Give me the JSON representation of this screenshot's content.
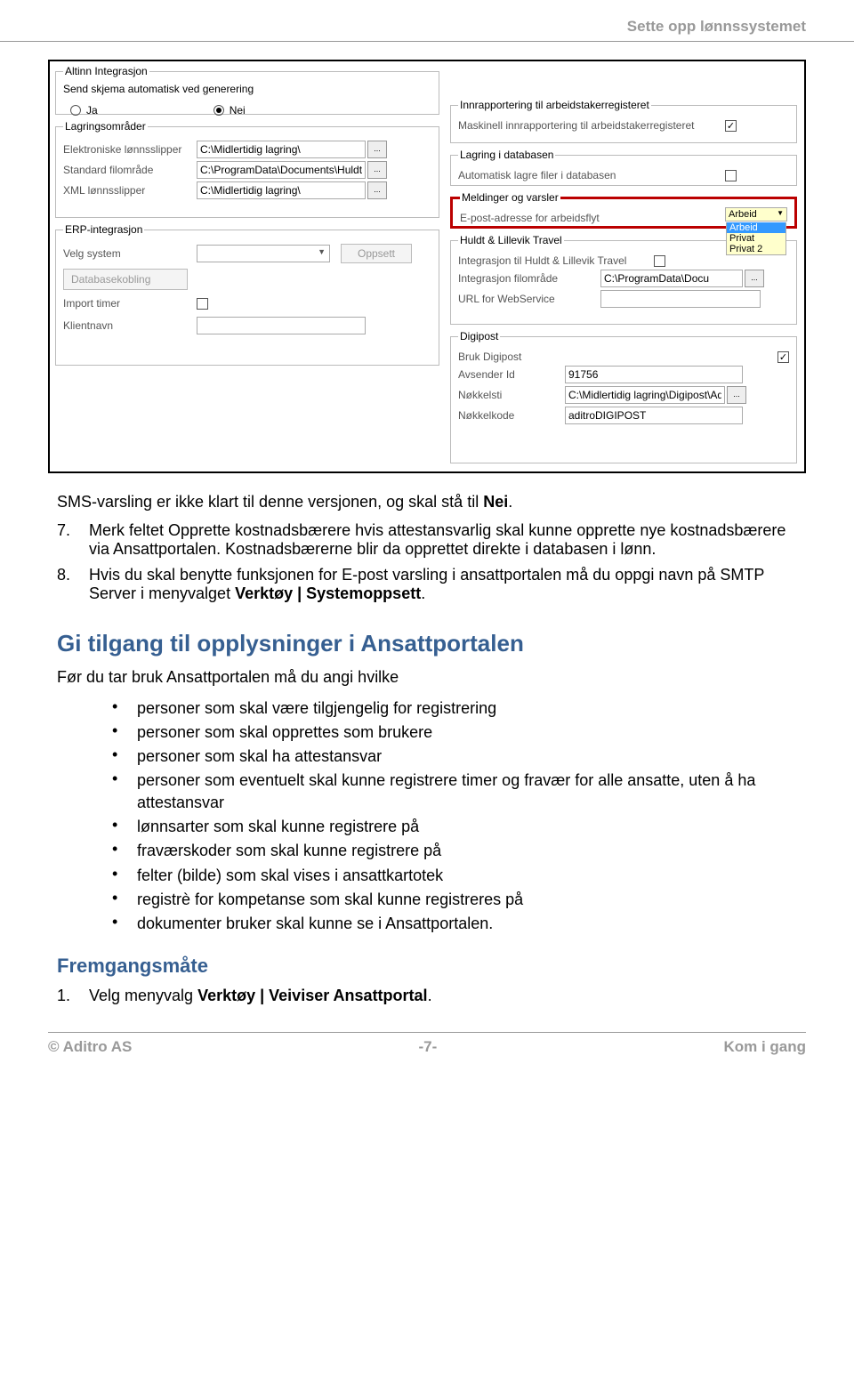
{
  "header": {
    "title": "Sette opp lønnssystemet"
  },
  "screenshot": {
    "altinn": {
      "legend": "Altinn Integrasjon",
      "sublabel": "Send skjema automatisk ved generering",
      "opt_yes": "Ja",
      "opt_no": "Nei"
    },
    "lagring": {
      "legend": "Lagringsområder",
      "r1_label": "Elektroniske lønnsslipper",
      "r1_value": "C:\\Midlertidig lagring\\",
      "r2_label": "Standard filområde",
      "r2_value": "C:\\ProgramData\\Documents\\HuldtLille\\",
      "r3_label": "XML lønnsslipper",
      "r3_value": "C:\\Midlertidig lagring\\"
    },
    "erp": {
      "legend": "ERP-integrasjon",
      "r1_label": "Velg system",
      "btn_oppsett": "Oppsett",
      "btn_db": "Databasekobling",
      "r2_label": "Import timer",
      "r3_label": "Klientnavn"
    },
    "innrap": {
      "legend": "Innrapportering til arbeidstakerregisteret",
      "label": "Maskinell innrapportering til arbeidstakerregisteret"
    },
    "lagdb": {
      "legend": "Lagring i databasen",
      "label": "Automatisk lagre filer i databasen"
    },
    "meld": {
      "legend": "Meldinger og varsler",
      "label": "E-post-adresse for arbeidsflyt",
      "selected": "Arbeid",
      "opts": [
        "Arbeid",
        "Privat",
        "Privat 2"
      ]
    },
    "travel": {
      "legend": "Huldt & Lillevik Travel",
      "r1_label": "Integrasjon til Huldt & Lillevik Travel",
      "r2_label": "Integrasjon filområde",
      "r2_value": "C:\\ProgramData\\Docu",
      "r3_label": "URL for WebService"
    },
    "digi": {
      "legend": "Digipost",
      "r1_label": "Bruk Digipost",
      "r2_label": "Avsender Id",
      "r2_value": "91756",
      "r3_label": "Nøkkelsti",
      "r3_value": "C:\\Midlertidig lagring\\Digipost\\Aditr",
      "r4_label": "Nøkkelkode",
      "r4_value": "aditroDIGIPOST"
    },
    "browse": "..."
  },
  "body": {
    "p1_a": "SMS-varsling er ikke klart til denne versjonen, og skal stå til ",
    "p1_b": "Nei",
    "p1_c": ".",
    "item7_a": "Merk feltet Opprette kostnadsbærere hvis attestansvarlig skal kunne opprette nye kostnadsbærere via Ansattportalen. Kostnadsbærerne blir da opprettet direkte i databasen i lønn.",
    "item8_a": "Hvis du skal benytte funksjonen for E-post varsling i ansattportalen må du oppgi navn på SMTP Server i menyvalget ",
    "item8_b": "Verktøy | Systemoppsett",
    "item8_c": ".",
    "h2": "Gi tilgang til opplysninger i Ansattportalen",
    "p2": "Før du tar bruk Ansattportalen må du angi hvilke",
    "bullets": [
      "personer som skal være tilgjengelig for registrering",
      "personer som skal opprettes som brukere",
      "personer som skal ha attestansvar",
      "personer som eventuelt skal kunne registrere timer og fravær for alle ansatte, uten å ha attestansvar",
      "lønnsarter som skal kunne registrere på",
      "fraværskoder som skal kunne registrere på",
      "felter (bilde) som skal vises i ansattkartotek",
      "registrè for kompetanse som skal kunne registreres på",
      "dokumenter bruker skal kunne se i Ansattportalen."
    ],
    "h3": "Fremgangsmåte",
    "step1_a": "Velg menyvalg ",
    "step1_b": "Verktøy | Veiviser Ansattportal",
    "step1_c": "."
  },
  "footer": {
    "left": "© Aditro AS",
    "center": "-7-",
    "right": "Kom i gang"
  }
}
